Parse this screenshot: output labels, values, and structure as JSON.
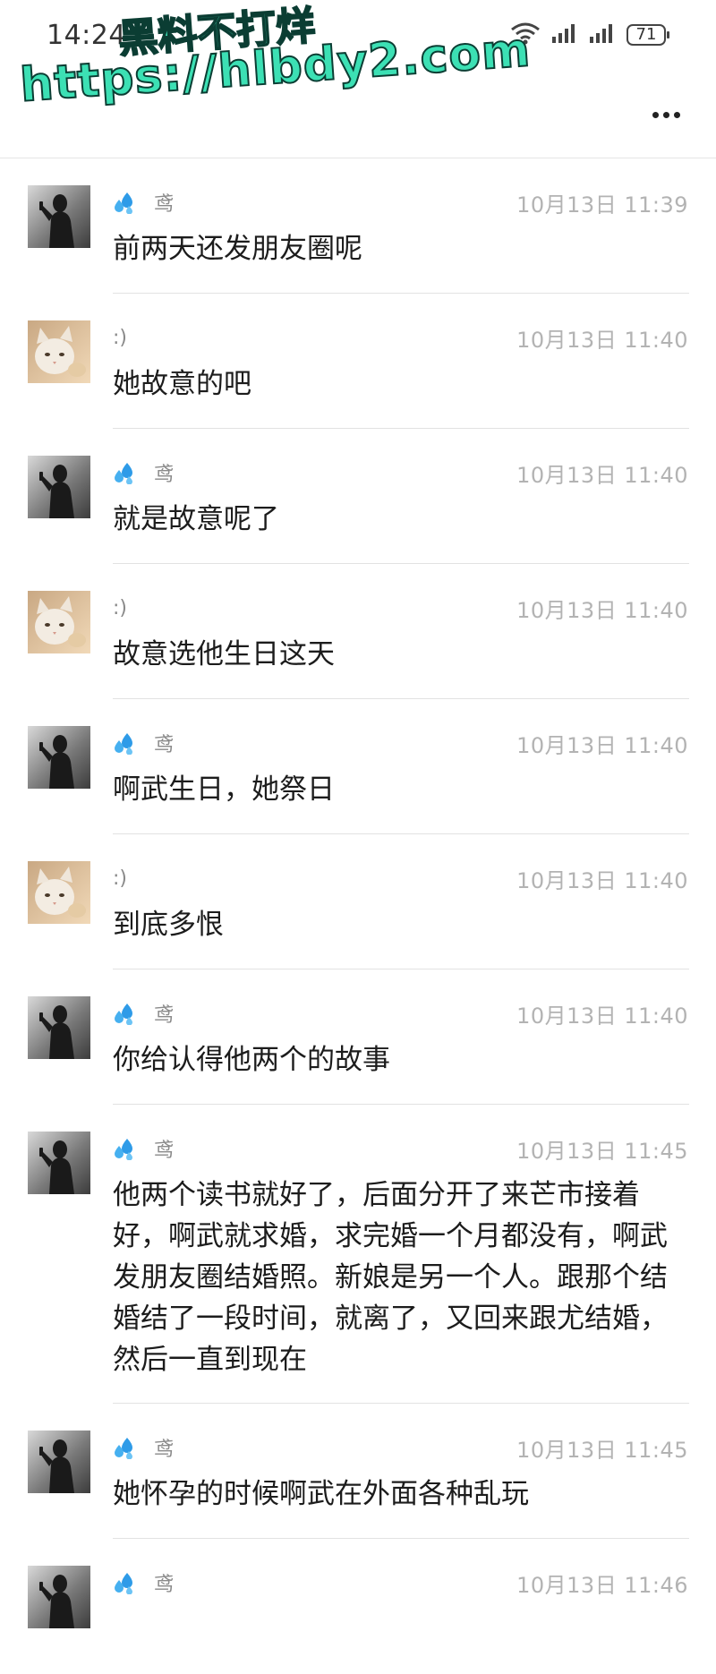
{
  "status_bar": {
    "time": "14:24",
    "battery": "71"
  },
  "watermark": {
    "line1": "黑料不打烊",
    "line2": "https://hlbdy2.com"
  },
  "messages": [
    {
      "sender": "鸢",
      "time": "10月13日 11:39",
      "text": "前两天还发朋友圈呢",
      "avatar": "silhouette"
    },
    {
      "sender": ":)",
      "time": "10月13日 11:40",
      "text": "她故意的吧",
      "avatar": "cat"
    },
    {
      "sender": "鸢",
      "time": "10月13日 11:40",
      "text": "就是故意呢了",
      "avatar": "silhouette"
    },
    {
      "sender": ":)",
      "time": "10月13日 11:40",
      "text": "故意选他生日这天",
      "avatar": "cat"
    },
    {
      "sender": "鸢",
      "time": "10月13日 11:40",
      "text": "啊武生日，她祭日",
      "avatar": "silhouette"
    },
    {
      "sender": ":)",
      "time": "10月13日 11:40",
      "text": "到底多恨",
      "avatar": "cat"
    },
    {
      "sender": "鸢",
      "time": "10月13日 11:40",
      "text": "你给认得他两个的故事",
      "avatar": "silhouette"
    },
    {
      "sender": "鸢",
      "time": "10月13日 11:45",
      "text": "他两个读书就好了，后面分开了来芒市接着好，啊武就求婚，求完婚一个月都没有，啊武发朋友圈结婚照。新娘是另一个人。跟那个结婚结了一段时间，就离了，又回来跟尤结婚，然后一直到现在",
      "avatar": "silhouette"
    },
    {
      "sender": "鸢",
      "time": "10月13日 11:45",
      "text": "她怀孕的时候啊武在外面各种乱玩",
      "avatar": "silhouette"
    },
    {
      "sender": "鸢",
      "time": "10月13日 11:46",
      "text": "",
      "avatar": "silhouette"
    }
  ]
}
